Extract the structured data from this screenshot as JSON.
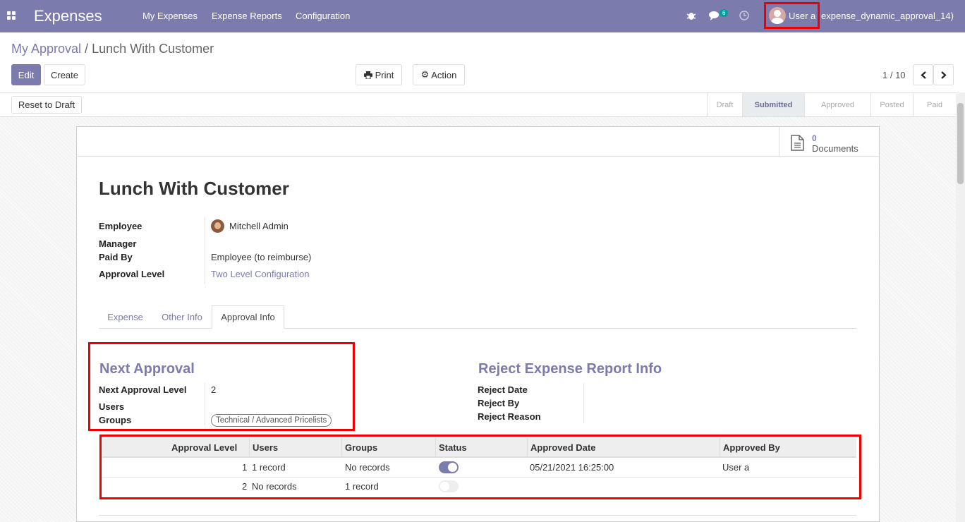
{
  "navbar": {
    "app_name": "Expenses",
    "menu": [
      "My Expenses",
      "Expense Reports",
      "Configuration"
    ],
    "chat_badge": "6",
    "user_name": "User a",
    "database": "expense_dynamic_approval_14)"
  },
  "breadcrumb": {
    "parent": "My Approval",
    "separator": "/",
    "current": "Lunch With Customer"
  },
  "buttons": {
    "edit": "Edit",
    "create": "Create",
    "print": "Print",
    "action": "Action",
    "reset": "Reset to Draft"
  },
  "pager": {
    "value": "1 / 10"
  },
  "stages": [
    {
      "label": "Draft",
      "active": false
    },
    {
      "label": "Submitted",
      "active": true
    },
    {
      "label": "Approved",
      "active": false
    },
    {
      "label": "Posted",
      "active": false
    },
    {
      "label": "Paid",
      "active": false
    }
  ],
  "documents": {
    "count": "0",
    "label": "Documents"
  },
  "record": {
    "title": "Lunch With Customer",
    "employee_label": "Employee",
    "employee": "Mitchell Admin",
    "manager_label": "Manager",
    "paid_by_label": "Paid By",
    "paid_by": "Employee (to reimburse)",
    "approval_level_label": "Approval Level",
    "approval_level": "Two Level Configuration"
  },
  "tabs": [
    "Expense",
    "Other Info",
    "Approval Info"
  ],
  "next_approval": {
    "title": "Next Approval",
    "level_label": "Next Approval Level",
    "level": "2",
    "users_label": "Users",
    "groups_label": "Groups",
    "group_tag": "Technical / Advanced Pricelists"
  },
  "reject_info": {
    "title": "Reject Expense Report Info",
    "date_label": "Reject Date",
    "by_label": "Reject By",
    "reason_label": "Reject Reason"
  },
  "approval_table": {
    "headers": [
      "Approval Level",
      "Users",
      "Groups",
      "Status",
      "Approved Date",
      "Approved By"
    ],
    "rows": [
      {
        "level": "1",
        "users": "1 record",
        "groups": "No records",
        "status": true,
        "date": "05/21/2021 16:25:00",
        "by": "User a"
      },
      {
        "level": "2",
        "users": "No records",
        "groups": "1 record",
        "status": false,
        "date": "",
        "by": ""
      }
    ]
  },
  "colors": {
    "brand": "#7c7bad",
    "highlight": "#e00000"
  }
}
